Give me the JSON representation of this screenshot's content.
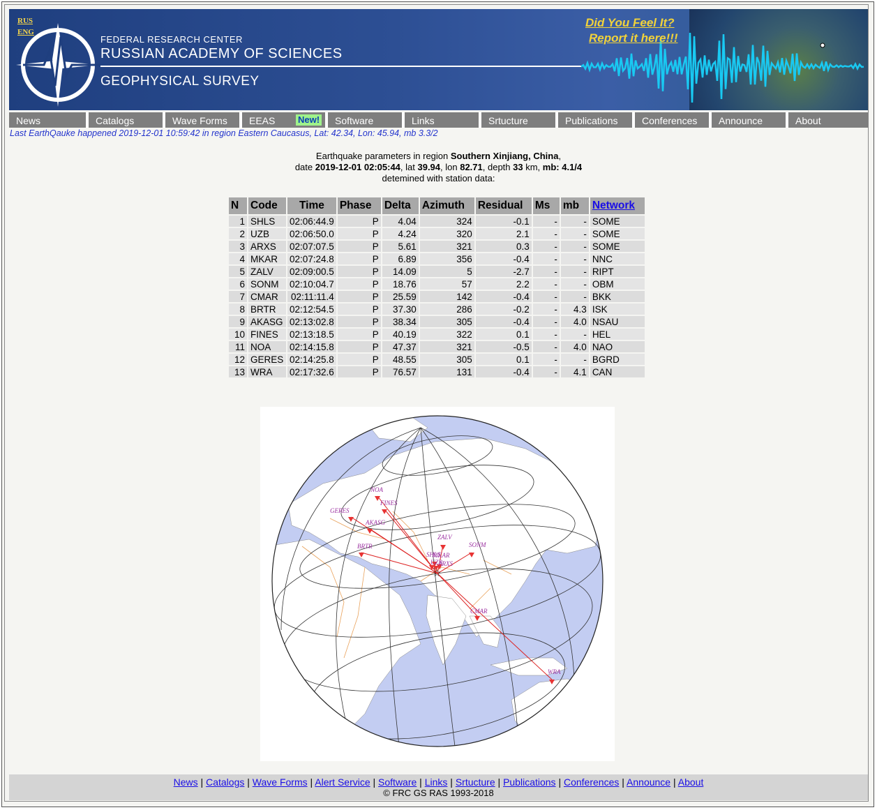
{
  "header": {
    "lang_rus": "RUS",
    "lang_eng": "ENG",
    "org_line1": "FEDERAL RESEARCH CENTER",
    "org_line2": "RUSSIAN ACADEMY OF SCIENCES",
    "org_line3": "GEOPHYSICAL SURVEY",
    "feel_line1": "Did You Feel It?",
    "feel_line2": "Report it here!!!"
  },
  "nav": {
    "items": [
      "News",
      "Catalogs",
      "Wave Forms",
      "EEAS",
      "Software",
      "Links",
      "Srtucture",
      "Publications",
      "Conferences",
      "Announce",
      "About"
    ],
    "new_badge": "New!"
  },
  "last_quake": "Last EarthQauke happened 2019-12-01 10:59:42 in region Eastern Caucasus, Lat: 42.34, Lon: 45.94, mb 3.3/2",
  "info": {
    "line1_prefix": "Earthquake parameters in region ",
    "region": "Southern Xinjiang, China",
    "line2_date_label": "date ",
    "datetime": "2019-12-01 02:05:44",
    "lat_label": ", lat ",
    "lat": "39.94",
    "lon_label": ", lon ",
    "lon": "82.71",
    "depth_label": ", depth ",
    "depth": "33",
    "depth_unit": " km, ",
    "mb_label": "mb: ",
    "mb": "4.1/4",
    "line3": "detemined with station data:"
  },
  "table": {
    "headers": [
      "N",
      "Code",
      "Time",
      "Phase",
      "Delta",
      "Azimuth",
      "Residual",
      "Ms",
      "mb",
      "Network"
    ],
    "rows": [
      [
        "1",
        "SHLS",
        "02:06:44.9",
        "P",
        "4.04",
        "324",
        "-0.1",
        "-",
        "-",
        "SOME"
      ],
      [
        "2",
        "UZB",
        "02:06:50.0",
        "P",
        "4.24",
        "320",
        "2.1",
        "-",
        "-",
        "SOME"
      ],
      [
        "3",
        "ARXS",
        "02:07:07.5",
        "P",
        "5.61",
        "321",
        "0.3",
        "-",
        "-",
        "SOME"
      ],
      [
        "4",
        "MKAR",
        "02:07:24.8",
        "P",
        "6.89",
        "356",
        "-0.4",
        "-",
        "-",
        "NNC"
      ],
      [
        "5",
        "ZALV",
        "02:09:00.5",
        "P",
        "14.09",
        "5",
        "-2.7",
        "-",
        "-",
        "RIPT"
      ],
      [
        "6",
        "SONM",
        "02:10:04.7",
        "P",
        "18.76",
        "57",
        "2.2",
        "-",
        "-",
        "OBM"
      ],
      [
        "7",
        "CMAR",
        "02:11:11.4",
        "P",
        "25.59",
        "142",
        "-0.4",
        "-",
        "-",
        "BKK"
      ],
      [
        "8",
        "BRTR",
        "02:12:54.5",
        "P",
        "37.30",
        "286",
        "-0.2",
        "-",
        "4.3",
        "ISK"
      ],
      [
        "9",
        "AKASG",
        "02:13:02.8",
        "P",
        "38.34",
        "305",
        "-0.4",
        "-",
        "4.0",
        "NSAU"
      ],
      [
        "10",
        "FINES",
        "02:13:18.5",
        "P",
        "40.19",
        "322",
        "0.1",
        "-",
        "-",
        "HEL"
      ],
      [
        "11",
        "NOA",
        "02:14:15.8",
        "P",
        "47.37",
        "321",
        "-0.5",
        "-",
        "4.0",
        "NAO"
      ],
      [
        "12",
        "GERES",
        "02:14:25.8",
        "P",
        "48.55",
        "305",
        "0.1",
        "-",
        "-",
        "BGRD"
      ],
      [
        "13",
        "WRA",
        "02:17:32.6",
        "P",
        "76.57",
        "131",
        "-0.4",
        "-",
        "4.1",
        "CAN"
      ]
    ]
  },
  "map": {
    "stations": [
      "NOA",
      "FINES",
      "GERES",
      "AKASG",
      "BRTR",
      "ZALV",
      "SONM",
      "MKAR",
      "SHLS",
      "UZB",
      "ARXS",
      "CMAR",
      "WRA"
    ],
    "colors": {
      "ocean": "#c3cdf2",
      "land": "#ffffff",
      "border": "#e8a15a",
      "grid": "#333333",
      "path": "#dd2222",
      "label": "#9b30a0"
    }
  },
  "footer": {
    "links": [
      "News",
      "Catalogs",
      "Wave Forms",
      "Alert Service",
      "Software",
      "Links",
      "Srtucture",
      "Publications",
      "Conferences",
      "Announce",
      "About"
    ],
    "copyright": "© FRC GS RAS 1993-2018"
  }
}
